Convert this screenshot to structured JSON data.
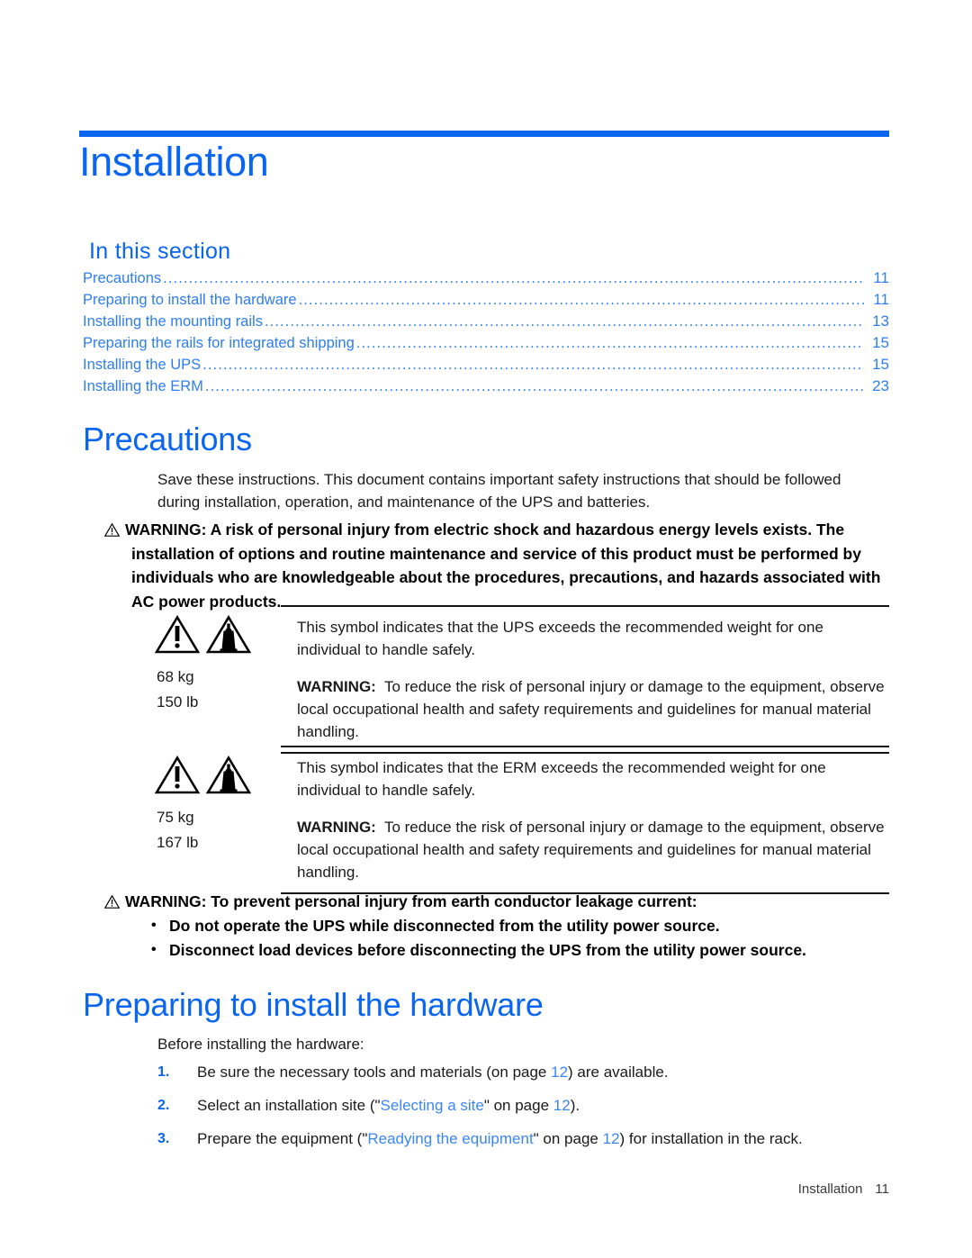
{
  "page": {
    "chapter_title": "Installation",
    "section_heading": "In this section",
    "footer_label": "Installation",
    "footer_page": "11",
    "accent_blue": "#0a66f0",
    "link_blue": "#3b86f2",
    "rule_color": "#141414"
  },
  "toc": {
    "items": [
      {
        "label": "Precautions",
        "page": "11"
      },
      {
        "label": "Preparing to install the hardware",
        "page": "11"
      },
      {
        "label": "Installing the mounting rails",
        "page": "13"
      },
      {
        "label": "Preparing the rails for integrated shipping",
        "page": "15"
      },
      {
        "label": "Installing the UPS",
        "page": "15"
      },
      {
        "label": "Installing the ERM",
        "page": "23"
      }
    ],
    "dots": "........................................................................................................................................................................"
  },
  "precautions": {
    "heading": "Precautions",
    "intro": "Save these instructions. This document contains important safety instructions that should be followed during installation, operation, and maintenance of the UPS and batteries.",
    "warning_main": "WARNING:  A risk of personal injury from electric shock and hazardous energy levels exists. The installation of options and routine maintenance and service of this product must be performed by individuals who are knowledgeable about the procedures, precautions, and hazards associated with AC power products.",
    "weight_tables": [
      {
        "icons": [
          "warning-triangle-icon",
          "heavy-weight-triangle-icon"
        ],
        "weight_kg": "68 kg",
        "weight_lb": "150 lb",
        "description": "This symbol indicates that the UPS exceeds the recommended weight for one individual to handle safely.",
        "warning_label": "WARNING:",
        "warning_text": "To reduce the risk of personal injury or damage to the equipment, observe local occupational health and safety requirements and guidelines for manual material handling."
      },
      {
        "icons": [
          "warning-triangle-icon",
          "heavy-weight-triangle-icon"
        ],
        "weight_kg": "75 kg",
        "weight_lb": "167 lb",
        "description": "This symbol indicates that the ERM exceeds the recommended weight for one individual to handle safely.",
        "warning_label": "WARNING:",
        "warning_text": "To reduce the risk of personal injury or damage to the equipment, observe local occupational health and safety requirements and guidelines for manual material handling."
      }
    ],
    "warning_leakage": {
      "lead": "WARNING:  To prevent personal injury from earth conductor leakage current:",
      "bullets": [
        "Do not operate the UPS while disconnected from the utility power source.",
        "Disconnect load devices before disconnecting the UPS from the utility power source."
      ],
      "bullet_glyph": "•"
    }
  },
  "preparing": {
    "heading": "Preparing to install the hardware",
    "intro": "Before installing the hardware:",
    "steps": [
      {
        "num": "1.",
        "pre": "Be sure the necessary tools and materials (on page ",
        "link": "",
        "mid": "",
        "page": "12",
        "post": ") are available."
      },
      {
        "num": "2.",
        "pre": "Select an installation site (\"",
        "link": "Selecting a site",
        "mid": "\" on page ",
        "page": "12",
        "post": ")."
      },
      {
        "num": "3.",
        "pre": "Prepare the equipment (\"",
        "link": "Readying the equipment",
        "mid": "\" on page ",
        "page": "12",
        "post": ") for installation in the rack."
      }
    ]
  }
}
